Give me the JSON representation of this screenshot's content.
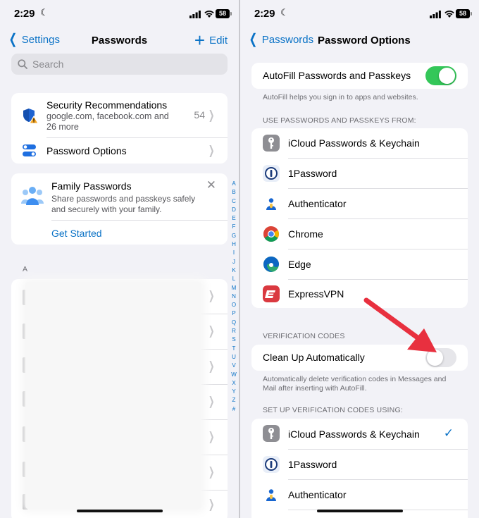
{
  "left": {
    "status": {
      "time": "2:29",
      "battery": "58"
    },
    "nav": {
      "back_label": "Settings",
      "title": "Passwords",
      "edit_label": "Edit"
    },
    "search": {
      "placeholder": "Search"
    },
    "security": {
      "title": "Security Recommendations",
      "subtitle": "google.com, facebook.com and 26 more",
      "count": "54"
    },
    "password_options": {
      "label": "Password Options"
    },
    "family": {
      "title": "Family Passwords",
      "subtitle": "Share passwords and passkeys safely and securely with your family.",
      "action": "Get Started"
    },
    "section_letter": "A",
    "index_letters": [
      "A",
      "B",
      "C",
      "D",
      "E",
      "F",
      "G",
      "H",
      "I",
      "J",
      "K",
      "L",
      "M",
      "N",
      "O",
      "P",
      "Q",
      "R",
      "S",
      "T",
      "U",
      "V",
      "W",
      "X",
      "Y",
      "Z",
      "#"
    ]
  },
  "right": {
    "status": {
      "time": "2:29",
      "battery": "58"
    },
    "nav": {
      "back_label": "Passwords",
      "title": "Password Options"
    },
    "autofill": {
      "label": "AutoFill Passwords and Passkeys",
      "enabled": true,
      "footer": "AutoFill helps you sign in to apps and websites."
    },
    "use_from": {
      "header": "USE PASSWORDS AND PASSKEYS FROM:",
      "items": [
        {
          "label": "iCloud Passwords & Keychain",
          "icon": "key-icon"
        },
        {
          "label": "1Password",
          "icon": "1password-icon"
        },
        {
          "label": "Authenticator",
          "icon": "authenticator-icon"
        },
        {
          "label": "Chrome",
          "icon": "chrome-icon"
        },
        {
          "label": "Edge",
          "icon": "edge-icon"
        },
        {
          "label": "ExpressVPN",
          "icon": "expressvpn-icon"
        }
      ]
    },
    "verification": {
      "header": "VERIFICATION CODES",
      "cleanup_label": "Clean Up Automatically",
      "cleanup_enabled": false,
      "footer": "Automatically delete verification codes in Messages and Mail after inserting with AutoFill."
    },
    "setup": {
      "header": "SET UP VERIFICATION CODES USING:",
      "items": [
        {
          "label": "iCloud Passwords & Keychain",
          "icon": "key-icon",
          "selected": true
        },
        {
          "label": "1Password",
          "icon": "1password-icon",
          "selected": false
        },
        {
          "label": "Authenticator",
          "icon": "authenticator-icon",
          "selected": false
        }
      ]
    }
  },
  "colors": {
    "accent": "#0a72c6",
    "toggle_on": "#34c759",
    "arrow": "#e8303f",
    "background": "#f2f2f7"
  }
}
